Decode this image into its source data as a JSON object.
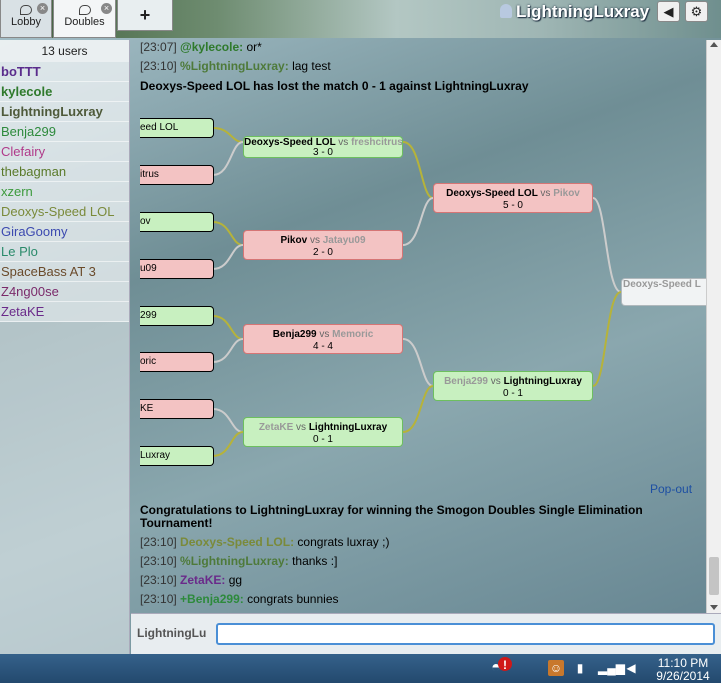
{
  "tabs": [
    {
      "label": "Lobby"
    },
    {
      "label": "Doubles"
    },
    {
      "label": "+"
    }
  ],
  "header": {
    "username": "LightningLuxray"
  },
  "userlist": {
    "count_label": "13 users",
    "users": [
      {
        "name": "boTTT",
        "color": "#5a2c8c",
        "bold": true
      },
      {
        "name": "kylecole",
        "color": "#2f7a2c",
        "bold": true
      },
      {
        "name": "LightningLuxray",
        "color": "#4e5a3a",
        "bold": true
      },
      {
        "name": "Benja299",
        "color": "#2d8a3c",
        "bold": false
      },
      {
        "name": "Clefairy",
        "color": "#b03a8a",
        "bold": false
      },
      {
        "name": "thebagman",
        "color": "#5a7a2a",
        "bold": false
      },
      {
        "name": "xzern",
        "color": "#3c9a3c",
        "bold": false
      },
      {
        "name": "Deoxys-Speed LOL",
        "color": "#7a8a3a",
        "bold": false
      },
      {
        "name": "GiraGoomy",
        "color": "#3c4ab0",
        "bold": false
      },
      {
        "name": "Le Plo",
        "color": "#2a8a6a",
        "bold": false
      },
      {
        "name": "SpaceBass AT 3",
        "color": "#6a4a2a",
        "bold": false
      },
      {
        "name": "Z4ng00se",
        "color": "#7a2a6a",
        "bold": false
      },
      {
        "name": "ZetaKE",
        "color": "#6a2a8a",
        "bold": false
      }
    ]
  },
  "chat": {
    "lines_top": [
      {
        "time": "[23:07]",
        "name": "@kylecole:",
        "text": "or*",
        "color": "#2f7a2c"
      },
      {
        "time": "[23:10]",
        "name": "%LightningLuxray:",
        "text": "lag test",
        "color": "#4e7a3a"
      }
    ],
    "notice1": "Deoxys-Speed LOL has lost the match 0 - 1 against LightningLuxray",
    "bracket": {
      "leaves": [
        "eed LOL",
        "itrus",
        "ov",
        "u09",
        "299",
        "oric",
        "KE",
        "Luxray"
      ],
      "r1": [
        {
          "p1": "Deoxys-Speed LOL",
          "vs": "vs",
          "p2": "freshcitrus",
          "score": "3 - 0"
        },
        {
          "p1": "Pikov",
          "vs": "vs",
          "p2": "Jatayu09",
          "score": "2 - 0"
        },
        {
          "p1": "Benja299",
          "vs": "vs",
          "p2": "Memoric",
          "score": "4 - 4"
        },
        {
          "p1": "ZetaKE",
          "vs": "vs",
          "p2": "LightningLuxray",
          "score": "0 - 1"
        }
      ],
      "r2": [
        {
          "p1": "Deoxys-Speed LOL",
          "vs": "vs",
          "p2": "Pikov",
          "score": "5 - 0"
        },
        {
          "p1": "Benja299",
          "vs": "vs",
          "p2": "LightningLuxray",
          "score": "0 - 1"
        }
      ],
      "r3": {
        "p1": "Deoxys-Speed L"
      },
      "popout": "Pop-out"
    },
    "notice2": "Congratulations to LightningLuxray for winning the Smogon Doubles Single Elimination Tournament!",
    "lines_bottom": [
      {
        "time": "[23:10]",
        "name": "Deoxys-Speed LOL:",
        "text": "congrats luxray ;)",
        "color": "#7a8a3a"
      },
      {
        "time": "[23:10]",
        "name": "%LightningLuxray:",
        "text": "thanks :]",
        "color": "#4e7a3a"
      },
      {
        "time": "[23:10]",
        "name": "ZetaKE:",
        "text": "gg",
        "color": "#6a2a8a"
      },
      {
        "time": "[23:10]",
        "name": "+Benja299:",
        "text": "congrats bunnies",
        "color": "#2d8a3c"
      }
    ]
  },
  "input": {
    "label": "LightningLu",
    "value": ""
  },
  "taskbar": {
    "time": "11:10 PM",
    "date": "9/26/2014"
  }
}
